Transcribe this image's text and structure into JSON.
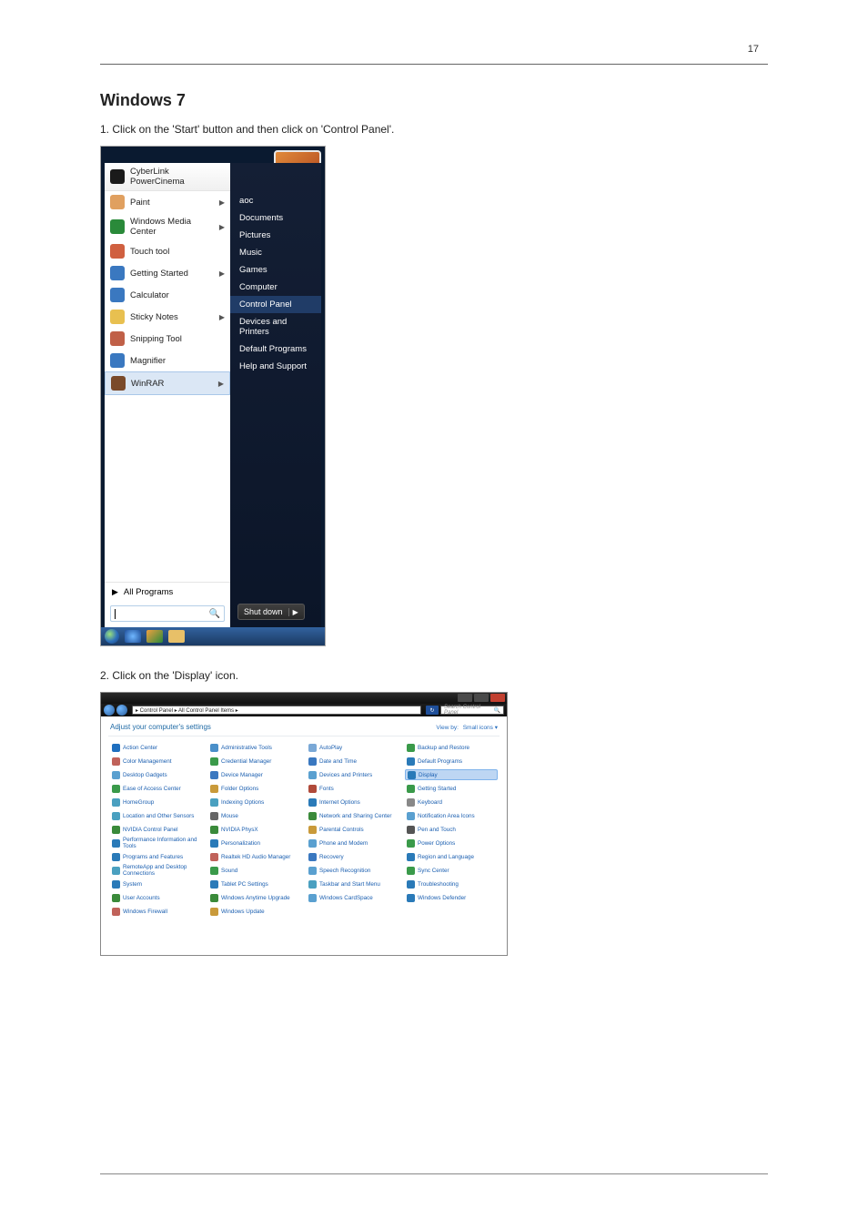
{
  "page_number": "17",
  "title": "Windows 7",
  "instructions": {
    "step1": "1. Click on the 'Start' button and then click on 'Control Panel'.",
    "step2": "2. Click on the 'Display' icon."
  },
  "start_menu": {
    "programs": [
      {
        "label": "CyberLink PowerCinema",
        "arrow": false
      },
      {
        "label": "Paint",
        "arrow": true
      },
      {
        "label": "Windows Media Center",
        "arrow": true
      },
      {
        "label": "Touch tool",
        "arrow": false
      },
      {
        "label": "Getting Started",
        "arrow": true
      },
      {
        "label": "Calculator",
        "arrow": false
      },
      {
        "label": "Sticky Notes",
        "arrow": true
      },
      {
        "label": "Snipping Tool",
        "arrow": false
      },
      {
        "label": "Magnifier",
        "arrow": false
      },
      {
        "label": "WinRAR",
        "arrow": true,
        "highlight": true
      }
    ],
    "all_programs": "All Programs",
    "right": [
      "aoc",
      "Documents",
      "Pictures",
      "Music",
      "Games",
      "Computer",
      "Control Panel",
      "Devices and Printers",
      "Default Programs",
      "Help and Support"
    ],
    "shutdown": "Shut down"
  },
  "control_panel": {
    "breadcrumb": "▸ Control Panel ▸ All Control Panel Items ▸",
    "search_placeholder": "Search Control Panel",
    "heading": "Adjust your computer's settings",
    "viewby_label": "View by:",
    "viewby_value": "Small icons ▾",
    "items": [
      "Action Center",
      "Administrative Tools",
      "AutoPlay",
      "Backup and Restore",
      "Color Management",
      "Credential Manager",
      "Date and Time",
      "Default Programs",
      "Desktop Gadgets",
      "Device Manager",
      "Devices and Printers",
      "Display",
      "Ease of Access Center",
      "Folder Options",
      "Fonts",
      "Getting Started",
      "HomeGroup",
      "Indexing Options",
      "Internet Options",
      "Keyboard",
      "Location and Other Sensors",
      "Mouse",
      "Network and Sharing Center",
      "Notification Area Icons",
      "NVIDIA Control Panel",
      "NVIDIA PhysX",
      "Parental Controls",
      "Pen and Touch",
      "Performance Information and Tools",
      "Personalization",
      "Phone and Modem",
      "Power Options",
      "Programs and Features",
      "Realtek HD Audio Manager",
      "Recovery",
      "Region and Language",
      "RemoteApp and Desktop Connections",
      "Sound",
      "Speech Recognition",
      "Sync Center",
      "System",
      "Tablet PC Settings",
      "Taskbar and Start Menu",
      "Troubleshooting",
      "User Accounts",
      "Windows Anytime Upgrade",
      "Windows CardSpace",
      "Windows Defender",
      "Windows Firewall",
      "Windows Update"
    ],
    "selected_index": 11,
    "icon_colors": [
      "#1f6fbf",
      "#4a8fc9",
      "#7aa8d6",
      "#3a9a4a",
      "#c0625a",
      "#3a9a4a",
      "#3a78c0",
      "#2a7ab8",
      "#5aa0d0",
      "#3a78c0",
      "#5aa0d0",
      "#2a7ab8",
      "#3a9a4a",
      "#c99a3a",
      "#b04a3a",
      "#3a9a4a",
      "#4aa0c0",
      "#4aa0c0",
      "#2a7ab8",
      "#888",
      "#4aa0c0",
      "#666",
      "#3a8a3a",
      "#5aa0d0",
      "#3a8a3a",
      "#3a8a3a",
      "#c99a3a",
      "#555",
      "#2a7ab8",
      "#2a7ab8",
      "#5aa0d0",
      "#3a9a4a",
      "#2a7ab8",
      "#c0625a",
      "#3a78c0",
      "#2a7ab8",
      "#4aa0c0",
      "#3a9a4a",
      "#5aa0d0",
      "#3a9a4a",
      "#2a7ab8",
      "#2a7ab8",
      "#4aa0c0",
      "#2a7ab8",
      "#3a8a3a",
      "#3a8a3a",
      "#5aa0d0",
      "#2a7ab8",
      "#c0625a",
      "#c99a3a"
    ]
  },
  "prog_icon_colors": [
    "#1a1a1a",
    "#e0a060",
    "#2a8a3a",
    "#d06040",
    "#3a78c0",
    "#3a78c0",
    "#e8c050",
    "#c06048",
    "#3a78c0",
    "#7a4a2a"
  ]
}
